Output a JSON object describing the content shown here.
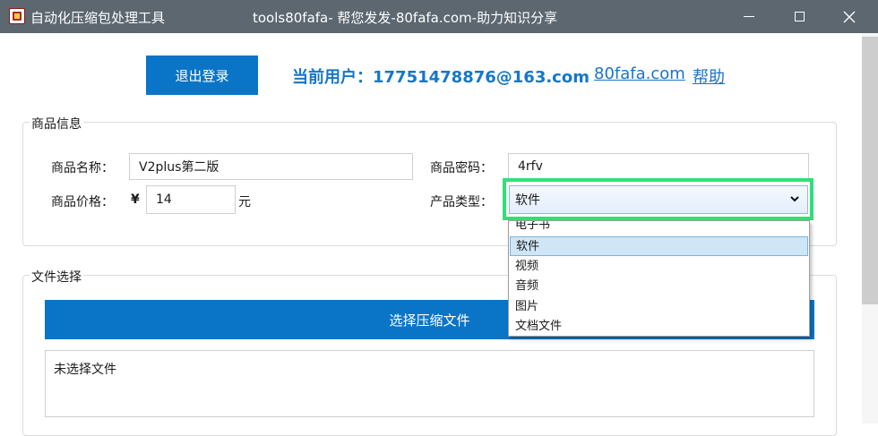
{
  "window": {
    "app_title": "自动化压缩包处理工具",
    "subtitle": "tools80fafa- 帮您发发-80fafa.com-助力知识分享",
    "buttons": [
      "minimize-icon",
      "maximize-icon",
      "close-icon"
    ]
  },
  "header": {
    "logout_label": "退出登录",
    "current_user": "当前用户：17751478876@163.com",
    "site_link": "80fafa.com",
    "help_link": "帮助"
  },
  "product": {
    "legend": "商品信息",
    "name_label": "商品名称：",
    "name_value": "V2plus第二版",
    "password_label": "商品密码：",
    "password_value": "4rfv",
    "price_label": "商品价格：",
    "currency_symbol": "¥",
    "price_value": "14",
    "price_unit": "元",
    "type_label": "产品类型：",
    "type_selected": "软件",
    "type_options": [
      "电子书",
      "软件",
      "视频",
      "音频",
      "图片",
      "文档文件"
    ]
  },
  "file": {
    "legend": "文件选择",
    "choose_label": "选择压缩文件",
    "status_text": "未选择文件"
  },
  "colors": {
    "titlebar": "#5c6770",
    "primary_button": "#0a75c7",
    "user_text": "#1677c9",
    "link": "#1a73c6",
    "highlight_frame": "#2fe07a",
    "selected_option": "#cfe6f7"
  }
}
